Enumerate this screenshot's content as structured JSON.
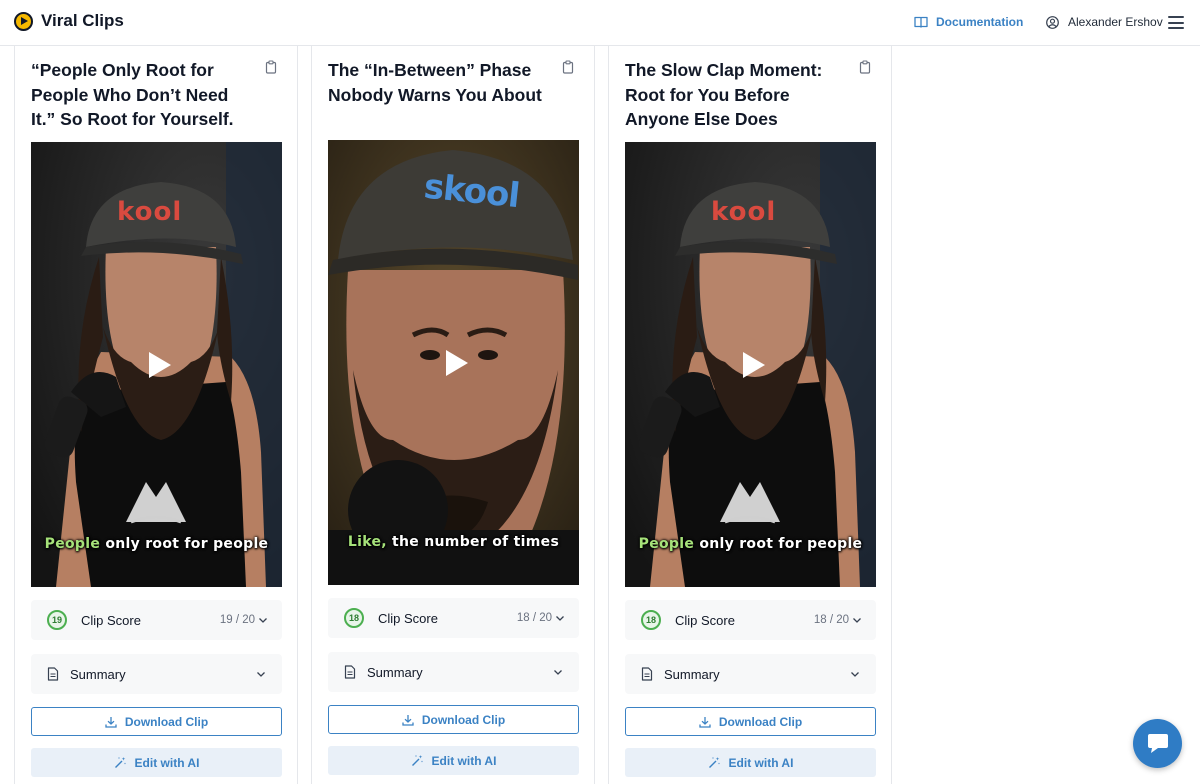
{
  "app": {
    "name": "Viral Clips"
  },
  "header": {
    "docs_label": "Documentation",
    "user_name": "Alexander Ershov"
  },
  "cards": [
    {
      "title": "“People Only Root for People Who Don’t Need It.” So Root for Yourself.",
      "caption_highlight": "People",
      "caption_rest": " only root for people",
      "score_badge": "19",
      "score_label": "Clip Score",
      "score_value": "19 / 20",
      "summary_label": "Summary",
      "download_label": "Download Clip",
      "edit_label": "Edit with AI"
    },
    {
      "title": "The “In-Between” Phase Nobody Warns You About",
      "caption_highlight": "Like,",
      "caption_rest": " the number of times",
      "score_badge": "18",
      "score_label": "Clip Score",
      "score_value": "18 / 20",
      "summary_label": "Summary",
      "download_label": "Download Clip",
      "edit_label": "Edit with AI"
    },
    {
      "title": "The Slow Clap Moment: Root for You Before Anyone Else Does",
      "caption_highlight": "People",
      "caption_rest": " only root for people",
      "score_badge": "18",
      "score_label": "Clip Score",
      "score_value": "18 / 20",
      "summary_label": "Summary",
      "download_label": "Download Clip",
      "edit_label": "Edit with AI"
    }
  ],
  "thumbnail": {
    "hat_text_wide": "kool",
    "hat_text_close": "skool"
  },
  "icons": {
    "logo": "play-circle-icon",
    "docs": "book-icon",
    "user": "user-circle-icon",
    "menu": "hamburger-icon",
    "copy": "clipboard-icon",
    "play": "play-icon",
    "summary": "document-icon",
    "download": "download-icon",
    "edit": "magic-wand-icon",
    "chat": "chat-icon"
  },
  "colors": {
    "accent": "#3b82c4",
    "brand": "#f5b800",
    "score": "#4caf50",
    "caption_highlight": "#a6e27a"
  }
}
